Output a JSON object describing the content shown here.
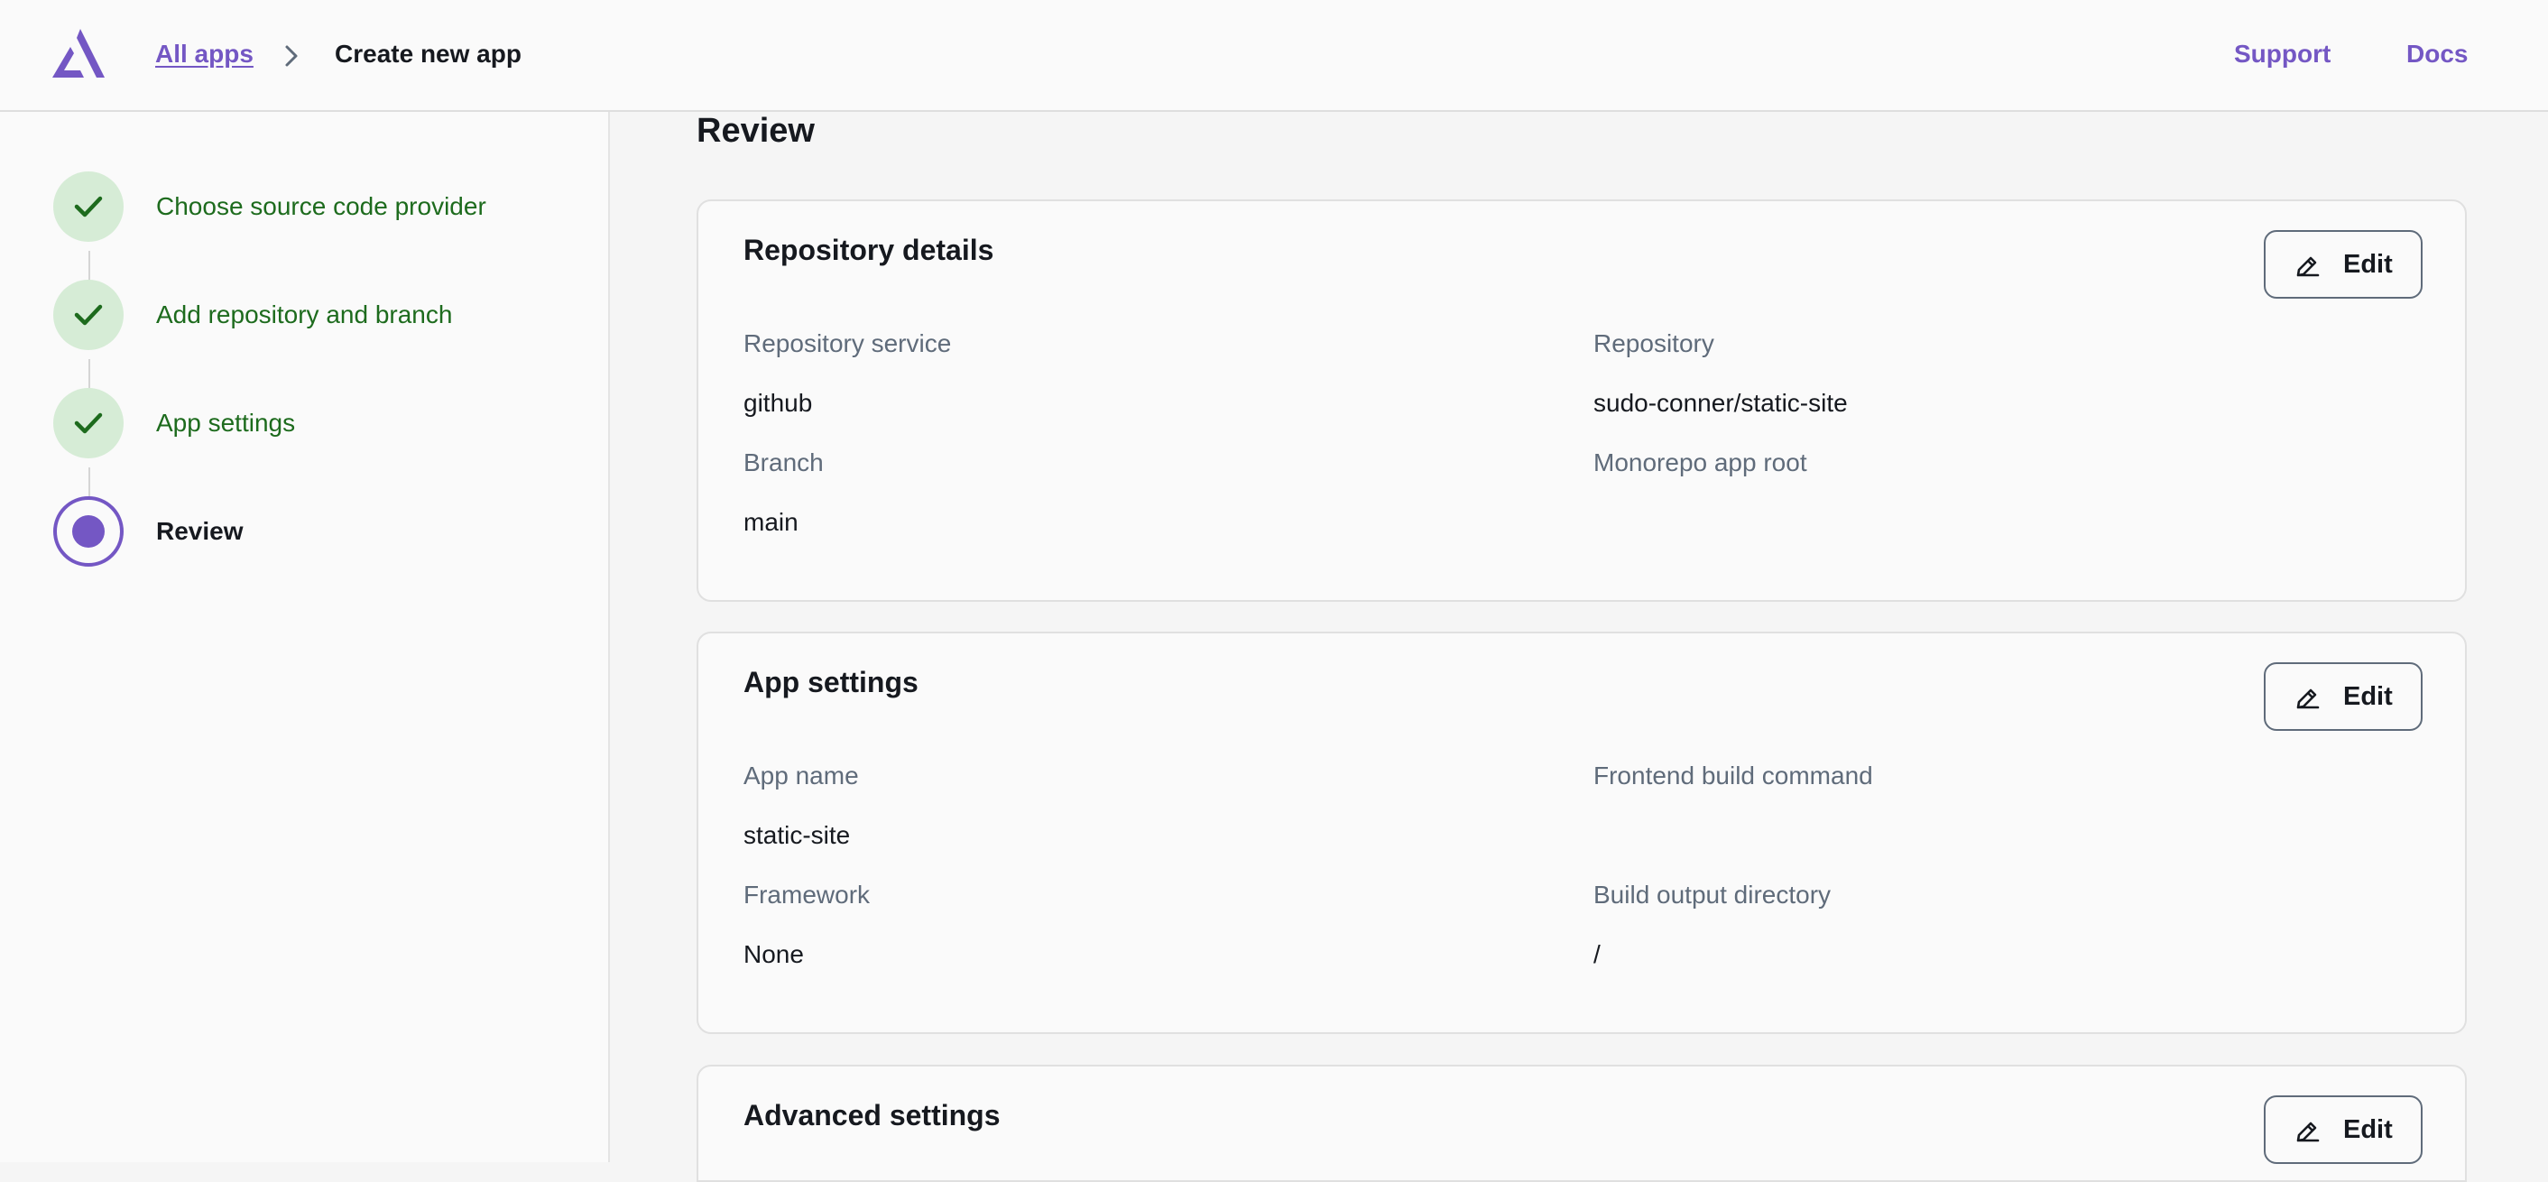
{
  "header": {
    "breadcrumb_link": "All apps",
    "breadcrumb_current": "Create new app",
    "support_label": "Support",
    "docs_label": "Docs"
  },
  "steps": [
    {
      "label": "Choose source code provider",
      "status": "completed"
    },
    {
      "label": "Add repository and branch",
      "status": "completed"
    },
    {
      "label": "App settings",
      "status": "completed"
    },
    {
      "label": "Review",
      "status": "current"
    }
  ],
  "main": {
    "title": "Review",
    "edit_label": "Edit",
    "repository_details": {
      "title": "Repository details",
      "repository_service_label": "Repository service",
      "repository_service_value": "github",
      "repository_label": "Repository",
      "repository_value": "sudo-conner/static-site",
      "branch_label": "Branch",
      "branch_value": "main",
      "monorepo_root_label": "Monorepo app root",
      "monorepo_root_value": ""
    },
    "app_settings": {
      "title": "App settings",
      "app_name_label": "App name",
      "app_name_value": "static-site",
      "build_command_label": "Frontend build command",
      "build_command_value": "",
      "framework_label": "Framework",
      "framework_value": "None",
      "output_dir_label": "Build output directory",
      "output_dir_value": "/"
    },
    "advanced_settings": {
      "title": "Advanced settings"
    }
  },
  "colors": {
    "accent": "#7457c4",
    "success_text": "#1d6b1d",
    "success_bg": "#d6ecd6",
    "muted_text": "#5f6b7a"
  },
  "icons": {
    "logo": "amplify-logo",
    "breadcrumb_separator": "chevron-right-icon",
    "step_completed": "check-icon",
    "edit": "pencil-icon"
  }
}
